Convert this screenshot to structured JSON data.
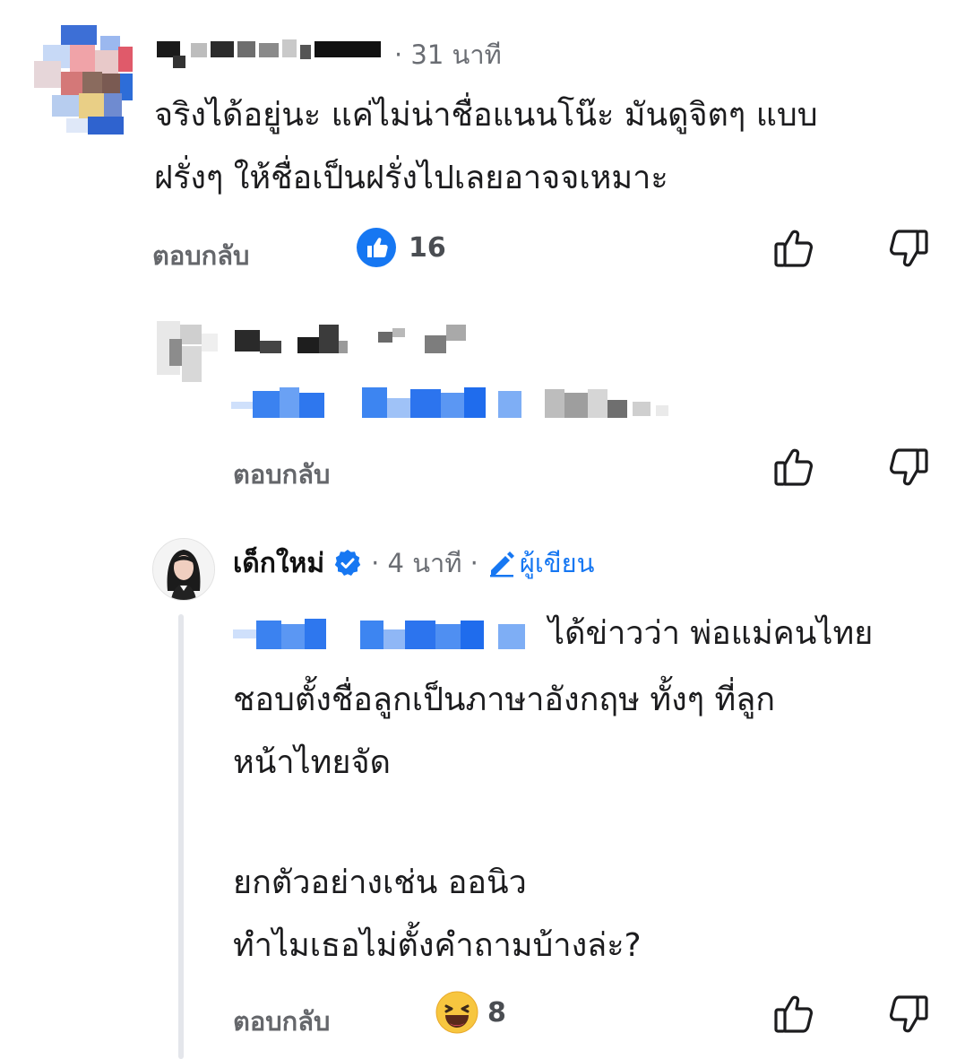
{
  "comment1": {
    "time": "· 31 นาที",
    "text_line1": "จริงได้อยู่นะ แค่ไม่น่าชื่อแนนโน๊ะ มันดูจิตๆ แบบ",
    "text_line2": "ฝรั่งๆ ให้ชื่อเป็นฝรั่งไปเลยอาจจเหมาะ",
    "reply_label": "ตอบกลับ",
    "reaction_icon": "like-reaction-icon",
    "reaction_count": "16"
  },
  "comment2": {
    "reply_label": "ตอบกลับ"
  },
  "comment3": {
    "author": "เด็กใหม่",
    "verified_icon": "verified-badge-icon",
    "time": "· 4 นาที ·",
    "author_badge": "ผู้เขียน",
    "text_line1": "ได้ข่าวว่า พ่อแม่คนไทย",
    "text_line2": "ชอบตั้งชื่อลูกเป็นภาษาอังกฤษ ทั้งๆ ที่ลูก",
    "text_line3": "หน้าไทยจัด",
    "text_line4": "ยกตัวอย่างเช่น ออนิว",
    "text_line5": "ทำไมเธอไม่ตั้งคำถามบ้างล่ะ?",
    "reply_label": "ตอบกลับ",
    "reaction_icon": "haha-reaction-icon",
    "reaction_count": "8"
  },
  "colors": {
    "facebook_blue": "#1677f2",
    "secondary_text": "#65676b",
    "thread_line": "#e4e6eb"
  }
}
